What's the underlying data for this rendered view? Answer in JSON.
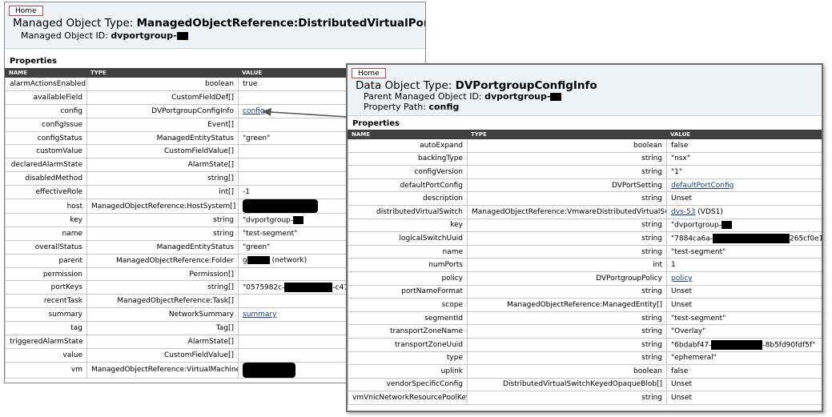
{
  "win1": {
    "home_label": "Home",
    "title_prefix": "Managed Object Type: ",
    "title_type": "ManagedObjectReference:DistributedVirtualPortgroup",
    "moid_label": "Managed Object ID: ",
    "moid_value": "dvportgroup-",
    "properties_label": "Properties",
    "columns": [
      "NAME",
      "TYPE",
      "VALUE"
    ],
    "rows": [
      {
        "name": "alarmActionsEnabled",
        "type": "boolean",
        "value": "true"
      },
      {
        "name": "availableField",
        "type": "CustomFieldDef[]",
        "value": ""
      },
      {
        "name": "config",
        "type": "DVPortgroupConfigInfo",
        "value": "config",
        "link": true
      },
      {
        "name": "configIssue",
        "type": "Event[]",
        "value": ""
      },
      {
        "name": "configStatus",
        "type": "ManagedEntityStatus",
        "value": "\"green\""
      },
      {
        "name": "customValue",
        "type": "CustomFieldValue[]",
        "value": ""
      },
      {
        "name": "declaredAlarmState",
        "type": "AlarmState[]",
        "value": ""
      },
      {
        "name": "disabledMethod",
        "type": "string[]",
        "value": ""
      },
      {
        "name": "effectiveRole",
        "type": "int[]",
        "value": "-1"
      },
      {
        "name": "host",
        "type": "ManagedObjectReference:HostSystem[]",
        "value": "",
        "redact": "blob"
      },
      {
        "name": "key",
        "type": "string",
        "value": "\"dvportgroup-",
        "redact": "small"
      },
      {
        "name": "name",
        "type": "string",
        "value": "\"test-segment\""
      },
      {
        "name": "overallStatus",
        "type": "ManagedEntityStatus",
        "value": "\"green\""
      },
      {
        "name": "parent",
        "type": "ManagedObjectReference:Folder",
        "value": "g",
        "redact": "mid",
        "suffix": " (network)"
      },
      {
        "name": "permission",
        "type": "Permission[]",
        "value": ""
      },
      {
        "name": "portKeys",
        "type": "string[]",
        "value": "\"0575982c-",
        "redact": "long",
        "suffix": "-c41"
      },
      {
        "name": "recentTask",
        "type": "ManagedObjectReference:Task[]",
        "value": ""
      },
      {
        "name": "summary",
        "type": "NetworkSummary",
        "value": "summary",
        "link": true
      },
      {
        "name": "tag",
        "type": "Tag[]",
        "value": ""
      },
      {
        "name": "triggeredAlarmState",
        "type": "AlarmState[]",
        "value": ""
      },
      {
        "name": "value",
        "type": "CustomFieldValue[]",
        "value": ""
      },
      {
        "name": "vm",
        "type": "ManagedObjectReference:VirtualMachine[]",
        "value": "",
        "redact": "blob2"
      }
    ]
  },
  "win2": {
    "home_label": "Home",
    "title_prefix": "Data Object Type: ",
    "title_type": "DVPortgroupConfigInfo",
    "parent_label": "Parent Managed Object ID: ",
    "parent_value": "dvportgroup-",
    "path_label": "Property Path: ",
    "path_value": "config",
    "properties_label": "Properties",
    "columns": [
      "NAME",
      "TYPE",
      "VALUE"
    ],
    "rows": [
      {
        "name": "autoExpand",
        "type": "boolean",
        "value": "false"
      },
      {
        "name": "backingType",
        "type": "string",
        "value": "\"nsx\"",
        "badge": "1"
      },
      {
        "name": "configVersion",
        "type": "string",
        "value": "\"1\""
      },
      {
        "name": "defaultPortConfig",
        "type": "DVPortSetting",
        "value": "defaultPortConfig",
        "link": true
      },
      {
        "name": "description",
        "type": "string",
        "value": "Unset"
      },
      {
        "name": "distributedVirtualSwitch",
        "type": "ManagedObjectReference:VmwareDistributedVirtualSwitch",
        "value": "dvs-53",
        "link": true,
        "suffix": " (VDS1)"
      },
      {
        "name": "key",
        "type": "string",
        "value": "\"dvportgroup-",
        "redact": "small"
      },
      {
        "name": "logicalSwitchUuid",
        "type": "string",
        "value": "\"7884ca6a-",
        "redact": "long2",
        "suffix": "265cf0e19f8\"",
        "badge": "4"
      },
      {
        "name": "name",
        "type": "string",
        "value": "\"test-segment\"",
        "badge": "2"
      },
      {
        "name": "numPorts",
        "type": "int",
        "value": "1"
      },
      {
        "name": "policy",
        "type": "DVPortgroupPolicy",
        "value": "policy",
        "link": true
      },
      {
        "name": "portNameFormat",
        "type": "string",
        "value": "Unset"
      },
      {
        "name": "scope",
        "type": "ManagedObjectReference:ManagedEntity[]",
        "value": "Unset"
      },
      {
        "name": "segmentId",
        "type": "string",
        "value": "\"test-segment\"",
        "badge": "2"
      },
      {
        "name": "transportZoneName",
        "type": "string",
        "value": "\"Overlay\""
      },
      {
        "name": "transportZoneUuid",
        "type": "string",
        "value": "\"6bdabf47-",
        "redact": "long3",
        "suffix": "-8b5fd90fdf5f\"",
        "badge": "3"
      },
      {
        "name": "type",
        "type": "string",
        "value": "\"ephemeral\"",
        "badge": "5"
      },
      {
        "name": "uplink",
        "type": "boolean",
        "value": "false"
      },
      {
        "name": "vendorSpecificConfig",
        "type": "DistributedVirtualSwitchKeyedOpaqueBlob[]",
        "value": "Unset"
      },
      {
        "name": "vmVnicNetworkResourcePoolKey",
        "type": "string",
        "value": "Unset"
      }
    ]
  }
}
